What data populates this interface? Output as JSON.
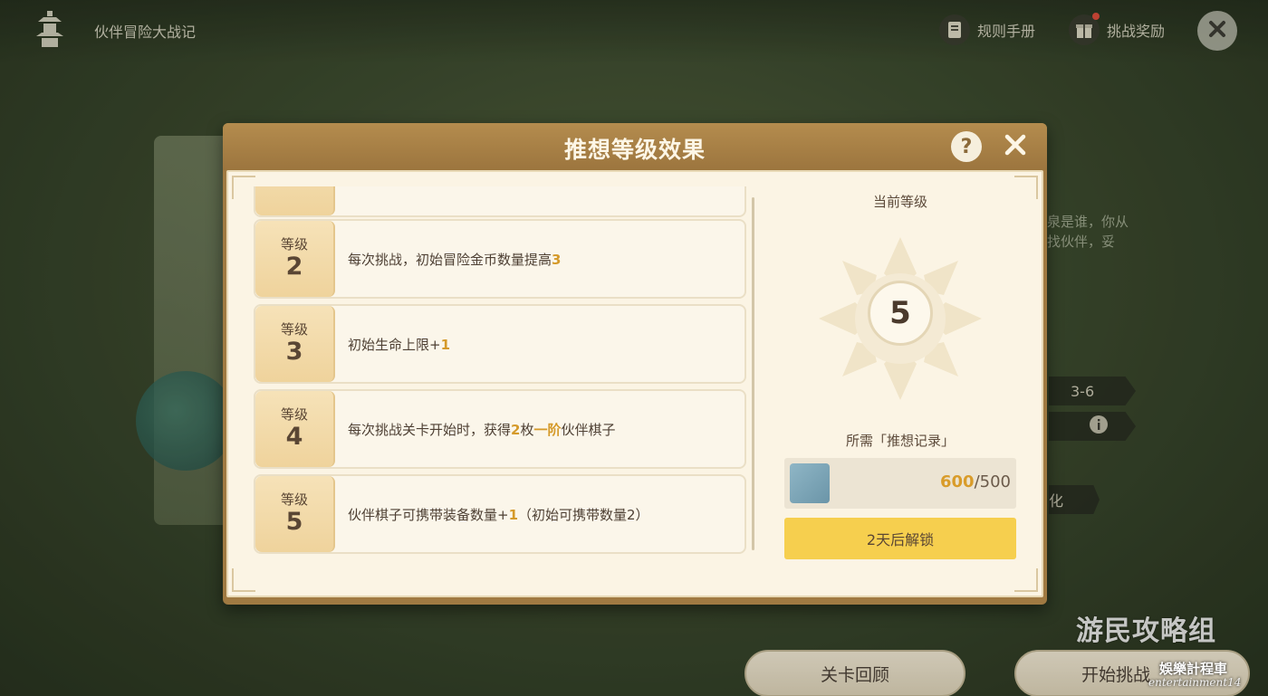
{
  "header": {
    "event_title": "伙伴冒险大战记",
    "rules_label": "规则手册",
    "rewards_label": "挑战奖励"
  },
  "background": {
    "desc_lines": [
      "泉是谁，你从",
      "找伙伴，妥"
    ],
    "stage_tag": "3-6",
    "stage_tag_suffix": "化",
    "review_button": "关卡回顾",
    "start_button": "开始挑战"
  },
  "dialog": {
    "title": "推想等级效果",
    "help_symbol": "?",
    "levels": [
      {
        "label": "等级",
        "level": "2",
        "parts": [
          {
            "t": "每次挑战，初始冒险金币数量提高",
            "hl": false
          },
          {
            "t": "3",
            "hl": true
          }
        ]
      },
      {
        "label": "等级",
        "level": "3",
        "parts": [
          {
            "t": "初始生命上限+",
            "hl": false
          },
          {
            "t": "1",
            "hl": true
          }
        ]
      },
      {
        "label": "等级",
        "level": "4",
        "parts": [
          {
            "t": "每次挑战关卡开始时，获得",
            "hl": false
          },
          {
            "t": "2",
            "hl": true
          },
          {
            "t": "枚",
            "hl": false
          },
          {
            "t": "一阶",
            "hl": true
          },
          {
            "t": "伙伴棋子",
            "hl": false
          }
        ]
      },
      {
        "label": "等级",
        "level": "5",
        "parts": [
          {
            "t": "伙伴棋子可携带装备数量+",
            "hl": false
          },
          {
            "t": "1",
            "hl": true
          },
          {
            "t": "（初始可携带数量2）",
            "hl": false
          }
        ]
      }
    ],
    "current_level_label": "当前等级",
    "current_level": "5",
    "required_label": "所需「推想记录」",
    "required_have": "600",
    "required_total": "/500",
    "unlock_button": "2天后解锁"
  },
  "watermark": {
    "site": "游民攻略组",
    "cn": "娛樂計程車",
    "en": "entertainment14"
  },
  "colors": {
    "dialog_frame": "#a07a42",
    "panel_bg": "#fbf4e4",
    "highlight": "#d59a2a",
    "unlock_button": "#f6cf4e"
  }
}
